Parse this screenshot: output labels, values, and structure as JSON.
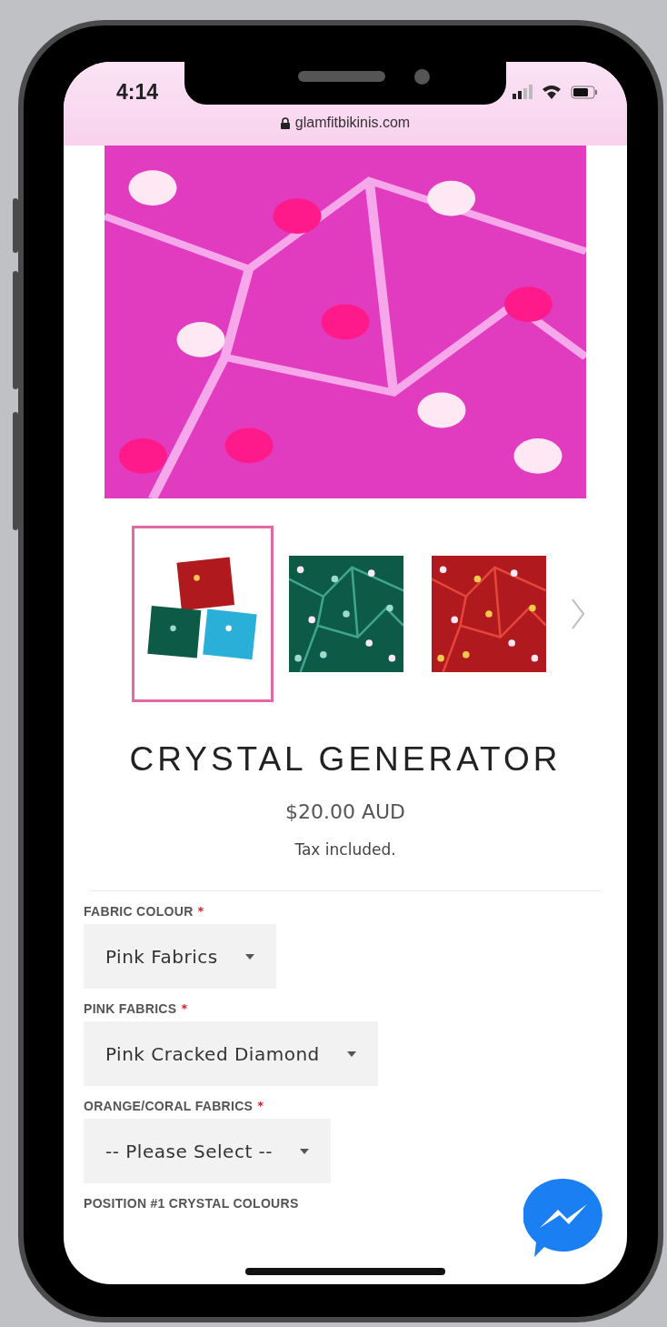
{
  "status_bar": {
    "time": "4:14",
    "url": "glamfitbikinis.com"
  },
  "gallery": {
    "thumbnails": [
      {
        "selected": true
      },
      {
        "selected": false
      },
      {
        "selected": false
      }
    ]
  },
  "product": {
    "title": "CRYSTAL GENERATOR",
    "price": "$20.00 AUD",
    "tax_note": "Tax included."
  },
  "options": [
    {
      "label": "FABRIC COLOUR",
      "required_mark": "*",
      "value": "Pink Fabrics"
    },
    {
      "label": "PINK FABRICS",
      "required_mark": "*",
      "value": "Pink Cracked Diamond"
    },
    {
      "label": "ORANGE/CORAL FABRICS",
      "required_mark": "*",
      "value": "-- Please Select --"
    },
    {
      "label": "POSITION #1 CRYSTAL COLOURS"
    }
  ]
}
